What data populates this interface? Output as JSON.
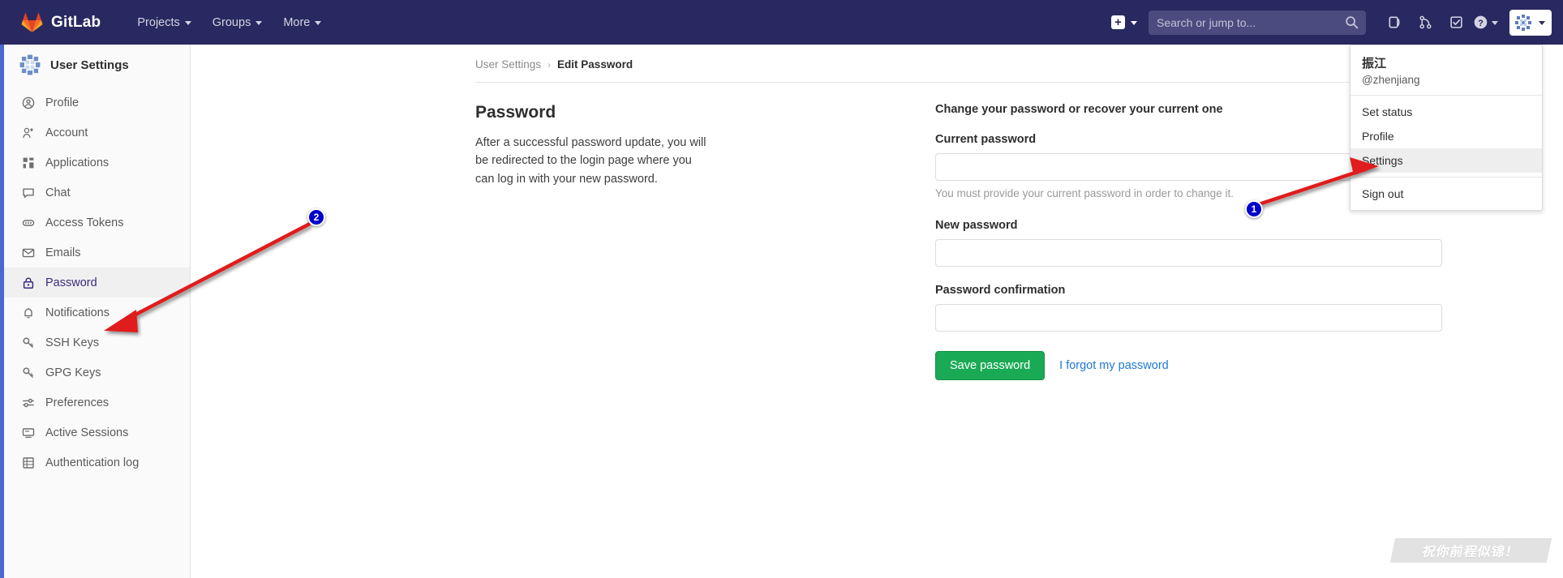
{
  "navbar": {
    "brand": "GitLab",
    "brand_logo_icon": "gitlab-tanuki-icon",
    "menu": [
      {
        "label": "Projects",
        "icon": "chevron-down-icon"
      },
      {
        "label": "Groups",
        "icon": "chevron-down-icon"
      },
      {
        "label": "More",
        "icon": "chevron-down-icon"
      }
    ],
    "create_new_icon": "plus-square-icon",
    "create_new_caret_icon": "chevron-down-icon",
    "search": {
      "placeholder": "Search or jump to...",
      "value": "",
      "icon": "search-icon"
    },
    "icons": [
      {
        "name": "issues-icon",
        "title": "Issues"
      },
      {
        "name": "merge-requests-icon",
        "title": "Merge requests"
      },
      {
        "name": "todos-icon",
        "title": "To-Do List"
      }
    ],
    "help_icon": "question-circle-icon",
    "help_caret_icon": "chevron-down-icon",
    "avatar_icon": "user-identicon-avatar",
    "avatar_caret_icon": "chevron-down-icon"
  },
  "user_dropdown": {
    "name": "振江",
    "handle": "@zhenjiang",
    "groups": [
      {
        "items": [
          {
            "label": "Set status",
            "highlighted": false
          },
          {
            "label": "Profile",
            "highlighted": false
          },
          {
            "label": "Settings",
            "highlighted": true
          }
        ]
      },
      {
        "items": [
          {
            "label": "Sign out",
            "highlighted": false
          }
        ]
      }
    ]
  },
  "sidebar": {
    "header": {
      "title": "User Settings",
      "avatar_icon": "user-identicon-avatar"
    },
    "items": [
      {
        "label": "Profile",
        "icon": "user-circle-icon",
        "active": false
      },
      {
        "label": "Account",
        "icon": "account-key-icon",
        "active": false
      },
      {
        "label": "Applications",
        "icon": "applications-icon",
        "active": false
      },
      {
        "label": "Chat",
        "icon": "chat-bubble-icon",
        "active": false
      },
      {
        "label": "Access Tokens",
        "icon": "token-icon",
        "active": false
      },
      {
        "label": "Emails",
        "icon": "envelope-icon",
        "active": false
      },
      {
        "label": "Password",
        "icon": "lock-icon",
        "active": true
      },
      {
        "label": "Notifications",
        "icon": "bell-icon",
        "active": false
      },
      {
        "label": "SSH Keys",
        "icon": "key-icon",
        "active": false
      },
      {
        "label": "GPG Keys",
        "icon": "key-icon",
        "active": false
      },
      {
        "label": "Preferences",
        "icon": "sliders-icon",
        "active": false
      },
      {
        "label": "Active Sessions",
        "icon": "monitor-icon",
        "active": false
      },
      {
        "label": "Authentication log",
        "icon": "log-grid-icon",
        "active": false
      }
    ]
  },
  "breadcrumb": {
    "root": "User Settings",
    "separator": "›",
    "current": "Edit Password"
  },
  "main": {
    "left": {
      "title": "Password",
      "description": "After a successful password update, you will be redirected to the login page where you can log in with your new password."
    },
    "form": {
      "lead": "Change your password or recover your current one",
      "current_password": {
        "label": "Current password",
        "value": "",
        "help": "You must provide your current password in order to change it."
      },
      "new_password": {
        "label": "New password",
        "value": ""
      },
      "password_confirmation": {
        "label": "Password confirmation",
        "value": ""
      },
      "save_button": "Save password",
      "forgot_link": "I forgot my password"
    }
  },
  "annotations": [
    {
      "label": "1"
    },
    {
      "label": "2"
    }
  ],
  "watermark": {
    "text": "祝你前程似锦！"
  },
  "colors": {
    "navbar_bg": "#292961",
    "sidebar_bg": "#fafafa",
    "active_accent": "#3c4ca8",
    "active_text": "#3c2a7d",
    "page_edge": "#4a68d4",
    "save_button": "#1aaa55",
    "link": "#1f78d1",
    "annotation_arrow": "#e01b1b",
    "annotation_badge": "#0000cc"
  }
}
